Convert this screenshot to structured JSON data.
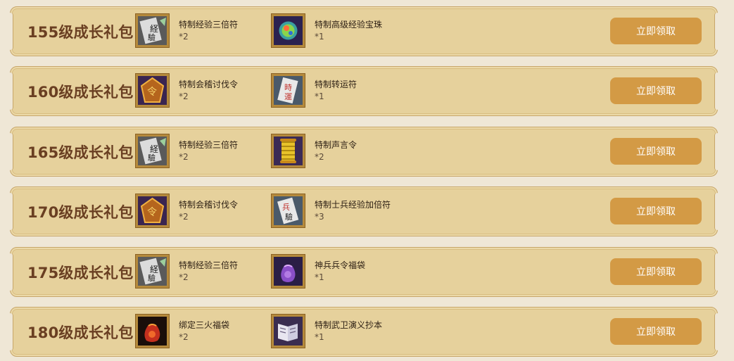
{
  "packs": [
    {
      "title": "155级成长礼包",
      "items": [
        {
          "name": "特制经验三倍符",
          "qty": "*2",
          "icon": "exp-triple-talisman-icon"
        },
        {
          "name": "特制高级经验宝珠",
          "qty": "*1",
          "icon": "exp-orb-icon"
        }
      ],
      "button": "立即领取"
    },
    {
      "title": "160级成长礼包",
      "items": [
        {
          "name": "特制会稽讨伐令",
          "qty": "*2",
          "icon": "crusade-token-icon"
        },
        {
          "name": "特制转运符",
          "qty": "*1",
          "icon": "luck-talisman-icon"
        }
      ],
      "button": "立即领取"
    },
    {
      "title": "165级成长礼包",
      "items": [
        {
          "name": "特制经验三倍符",
          "qty": "*2",
          "icon": "exp-triple-talisman-icon"
        },
        {
          "name": "特制声言令",
          "qty": "*2",
          "icon": "scroll-icon"
        }
      ],
      "button": "立即领取"
    },
    {
      "title": "170级成长礼包",
      "items": [
        {
          "name": "特制会稽讨伐令",
          "qty": "*2",
          "icon": "crusade-token-icon"
        },
        {
          "name": "特制士兵经验加倍符",
          "qty": "*3",
          "icon": "soldier-exp-talisman-icon"
        }
      ],
      "button": "立即领取"
    },
    {
      "title": "175级成长礼包",
      "items": [
        {
          "name": "特制经验三倍符",
          "qty": "*2",
          "icon": "exp-triple-talisman-icon"
        },
        {
          "name": "神兵兵令福袋",
          "qty": "*1",
          "icon": "purple-lucky-bag-icon"
        }
      ],
      "button": "立即领取"
    },
    {
      "title": "180级成长礼包",
      "items": [
        {
          "name": "绑定三火福袋",
          "qty": "*2",
          "icon": "red-lucky-bag-icon"
        },
        {
          "name": "特制武卫演义抄本",
          "qty": "*1",
          "icon": "book-icon"
        }
      ],
      "button": "立即领取"
    }
  ],
  "colors": {
    "page_bg": "#efe7d6",
    "row_bg": "#e6d19c",
    "row_border": "#c7a66a",
    "title": "#6a3f22",
    "button_bg": "#d39a45",
    "button_text": "#ffffff"
  }
}
